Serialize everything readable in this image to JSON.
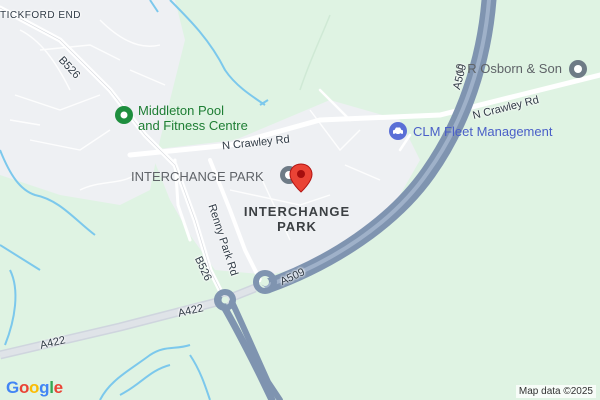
{
  "map": {
    "area_label_line1": "INTERCHANGE",
    "area_label_line2": "PARK",
    "place_label": "TICKFORD END",
    "roads": {
      "b526_north": "B526",
      "b526_south": "B526",
      "n_crawley_west": "N Crawley Rd",
      "n_crawley_east": "N Crawley Rd",
      "a509_north": "A509",
      "a509_south": "A509",
      "a422_mid": "A422",
      "a422_west": "A422",
      "renny_park": "Renny Park Rd"
    },
    "pois": {
      "middleton_line1": "Middleton Pool",
      "middleton_line2": "and Fitness Centre",
      "interchange_park": "INTERCHANGE PARK",
      "sr_osborn": "S R Osborn & Son",
      "clm_fleet": "CLM Fleet Management"
    },
    "google_logo": [
      "G",
      "o",
      "o",
      "g",
      "l",
      "e"
    ],
    "attribution": "Map data ©2025",
    "colors": {
      "land": "#dff3e3",
      "urban": "#eef0f3",
      "water": "#7cc8ec",
      "motorway": "#8fa4bf",
      "road": "#ffffff",
      "pin": "#ea4335",
      "green_poi": "#1e8e3e",
      "blue_poi": "#5a6fd6"
    },
    "icons": [
      "location-pin-icon",
      "park-icon",
      "place-icon",
      "car-icon"
    ]
  }
}
